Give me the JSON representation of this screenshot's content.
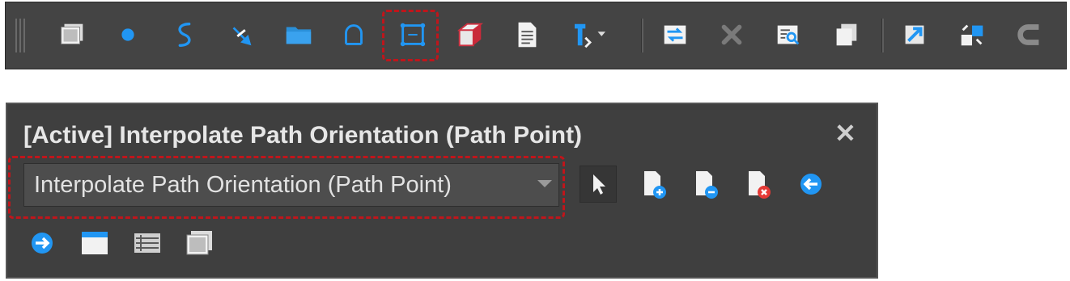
{
  "toolbar": {
    "buttons": [
      {
        "icon": "layers-icon"
      },
      {
        "icon": "dot-icon"
      },
      {
        "icon": "path-curve-icon"
      },
      {
        "icon": "diagonal-arrows-icon"
      },
      {
        "icon": "folder-icon"
      },
      {
        "icon": "arc-shape-icon"
      },
      {
        "icon": "frame-path-icon"
      },
      {
        "icon": "box-icon"
      },
      {
        "icon": "document-icon"
      },
      {
        "icon": "tool-dropdown-icon"
      },
      {
        "icon": "swap-icon"
      },
      {
        "icon": "delete-icon"
      },
      {
        "icon": "inspect-icon"
      },
      {
        "icon": "copy-icon"
      },
      {
        "icon": "resize-icon"
      },
      {
        "icon": "rotate-icon"
      },
      {
        "icon": "c-shape-icon"
      }
    ]
  },
  "panel": {
    "title": "[Active] Interpolate Path Orientation (Path Point)",
    "close_label": "✕",
    "dropdown": {
      "value": "Interpolate Path Orientation (Path Point)"
    }
  },
  "colors": {
    "accent": "#2196f3",
    "highlight": "#c0151b",
    "toolbar_bg": "#444444",
    "panel_bg": "#3f3f3f"
  }
}
